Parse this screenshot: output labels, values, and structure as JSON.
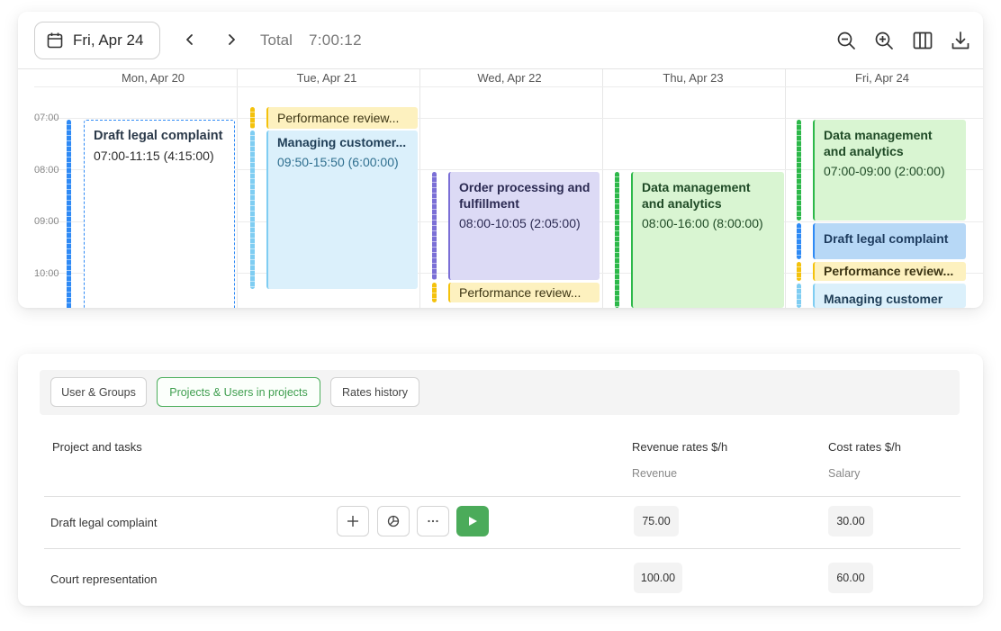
{
  "toolbar": {
    "date": "Fri, Apr 24",
    "total_label": "Total",
    "total_value": "7:00:12"
  },
  "days": [
    "Mon, Apr 20",
    "Tue, Apr 21",
    "Wed, Apr 22",
    "Thu, Apr 23",
    "Fri, Apr 24"
  ],
  "times": [
    "07:00",
    "08:00",
    "09:00",
    "10:00"
  ],
  "events": {
    "mon_legal": {
      "title": "Draft legal complaint",
      "time": "07:00-11:15 (4:15:00)"
    },
    "tue_perf": {
      "title": "Performance review..."
    },
    "tue_customer": {
      "title": "Managing customer...",
      "time": "09:50-15:50 (6:00:00)"
    },
    "wed_order": {
      "title": "Order processing and fulfillment",
      "time": "08:00-10:05 (2:05:00)"
    },
    "wed_perf": {
      "title": "Performance review..."
    },
    "thu_data": {
      "title": "Data management and analytics",
      "time": "08:00-16:00 (8:00:00)"
    },
    "fri_data": {
      "title": "Data management and analytics",
      "time": "07:00-09:00 (2:00:00)"
    },
    "fri_legal": {
      "title": "Draft legal complaint"
    },
    "fri_perf": {
      "title": "Performance review..."
    },
    "fri_customer": {
      "title": "Managing customer"
    }
  },
  "colors": {
    "blue_stripe": "#2f8af5",
    "light_blue": "#dbf0fb",
    "light_blue_stripe": "#7fcdf2",
    "yellow": "#fdf1bf",
    "yellow_stripe": "#f4c20d",
    "purple": "#dcdaf5",
    "purple_stripe": "#7b6fd6",
    "green": "#d9f5d2",
    "green_stripe": "#2db84a",
    "accent_green": "#4bab5a"
  },
  "tabs": [
    "User & Groups",
    "Projects & Users in projects",
    "Rates history"
  ],
  "table": {
    "col_project": "Project and tasks",
    "col_revenue": "Revenue rates $/h",
    "col_revenue_sub": "Revenue",
    "col_cost": "Cost rates $/h",
    "col_cost_sub": "Salary",
    "rows": [
      {
        "name": "Draft legal complaint",
        "revenue": "75.00",
        "cost": "30.00"
      },
      {
        "name": "Court representation",
        "revenue": "100.00",
        "cost": "60.00"
      }
    ]
  }
}
